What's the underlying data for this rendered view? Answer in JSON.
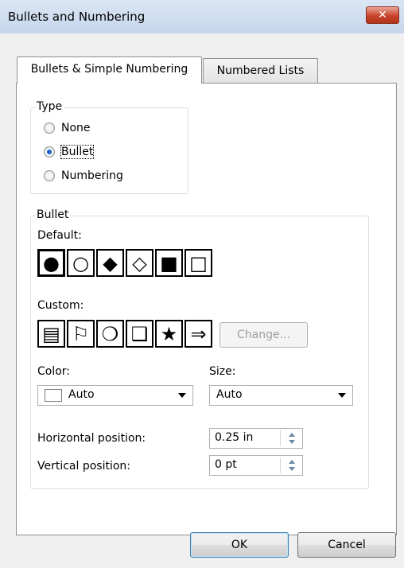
{
  "window": {
    "title": "Bullets and Numbering",
    "close_glyph": "✕"
  },
  "tabs": [
    {
      "label": "Bullets & Simple Numbering",
      "active": true
    },
    {
      "label": "Numbered Lists",
      "active": false
    }
  ],
  "type_group": {
    "label": "Type",
    "options": [
      {
        "label": "None",
        "checked": false
      },
      {
        "label": "Bullet",
        "checked": true
      },
      {
        "label": "Numbering",
        "checked": false
      }
    ]
  },
  "bullet_group": {
    "label": "Bullet",
    "default_label": "Default:",
    "default_bullets": [
      {
        "glyph": "●",
        "icon": "filled-circle-icon",
        "selected": true
      },
      {
        "glyph": "○",
        "icon": "hollow-circle-icon",
        "selected": false
      },
      {
        "glyph": "◆",
        "icon": "filled-diamond-icon",
        "selected": false
      },
      {
        "glyph": "◇",
        "icon": "hollow-diamond-icon",
        "selected": false
      },
      {
        "glyph": "■",
        "icon": "filled-square-icon",
        "selected": false
      },
      {
        "glyph": "□",
        "icon": "hollow-square-icon",
        "selected": false
      }
    ],
    "custom_label": "Custom:",
    "custom_bullets": [
      {
        "glyph": "▤",
        "icon": "document-icon"
      },
      {
        "glyph": "⚐",
        "icon": "flag-icon"
      },
      {
        "glyph": "❍",
        "icon": "shadow-circle-icon"
      },
      {
        "glyph": "❑",
        "icon": "shadow-square-icon"
      },
      {
        "glyph": "★",
        "icon": "star-icon"
      },
      {
        "glyph": "⇒",
        "icon": "double-arrow-icon"
      }
    ],
    "change_button": "Change...",
    "color_label": "Color:",
    "color_value": "Auto",
    "size_label": "Size:",
    "size_value": "Auto",
    "horizontal_label": "Horizontal position:",
    "horizontal_value": "0.25 in",
    "vertical_label": "Vertical position:",
    "vertical_value": "0 pt"
  },
  "footer": {
    "ok": "OK",
    "cancel": "Cancel"
  }
}
